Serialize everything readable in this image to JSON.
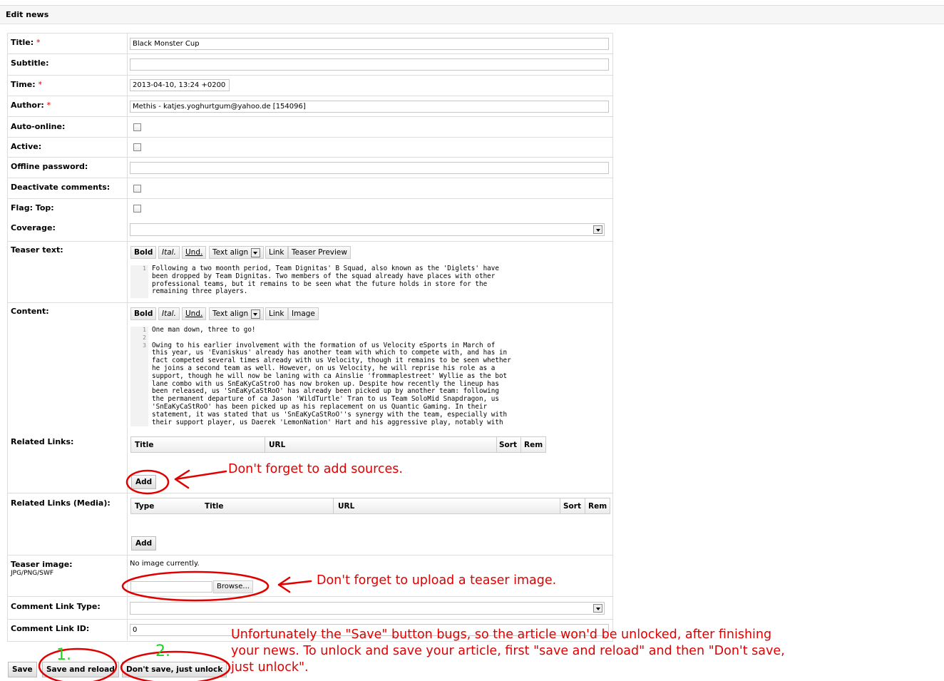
{
  "header": {
    "title": "Edit news"
  },
  "form": {
    "title_label": "Title:",
    "title_value": "Black Monster Cup",
    "subtitle_label": "Subtitle:",
    "subtitle_value": "",
    "time_label": "Time:",
    "time_value": "2013-04-10, 13:24 +0200",
    "author_label": "Author:",
    "author_value": "Methis - katjes.yoghurtgum@yahoo.de [154096]",
    "autoonline_label": "Auto-online:",
    "active_label": "Active:",
    "offline_label": "Offline password:",
    "offline_value": "",
    "deactivate_label": "Deactivate comments:",
    "flagtop_label": "Flag: Top:",
    "coverage_label": "Coverage:",
    "coverage_value": "",
    "teaser_label": "Teaser text:",
    "content_label": "Content:",
    "related_label": "Related Links:",
    "related_media_label": "Related Links (Media):",
    "teaser_image_label": "Teaser image:",
    "teaser_image_formats": "JPG/PNG/SWF",
    "no_image_text": "No image currently.",
    "browse_label": "Browse...",
    "comment_type_label": "Comment Link Type:",
    "comment_type_value": "",
    "comment_id_label": "Comment Link ID:",
    "comment_id_value": "0",
    "required_mark": "*"
  },
  "toolbar": {
    "bold": "Bold",
    "italic": "Ital.",
    "underline": "Und.",
    "text_align": "Text align",
    "link": "Link",
    "teaser_preview": "Teaser Preview",
    "image": "Image"
  },
  "teaser_editor": {
    "line_numbers": "1",
    "text": "Following a two moonth period, Team Dignitas' B Squad, also known as the 'Diglets' have\nbeen dropped by Team Dignitas. Two members of the squad already have places with other\nprofessional teams, but it remains to be seen what the future holds in store for the\nremaining three players."
  },
  "content_editor": {
    "line_numbers": "1\n2\n3",
    "text": "One man down, three to go!\n\nOwing to his earlier involvement with the formation of us Velocity eSports in March of\nthis year, us 'Evaniskus' already has another team with which to compete with, and has in\nfact competed several times already with us Velocity, though it remains to be seen whether\nhe joins a second team as well. However, on us Velocity, he will reprise his role as a\nsupport, though he will now be laning with ca Ainslie 'frommaplestreet' Wyllie as the bot\nlane combo with us SnEaKyCaStroO has now broken up. Despite how recently the lineup has\nbeen released, us 'SnEaKyCaStRoO' has already been picked up by another team: following\nthe permanent departure of ca Jason 'WildTurtle' Tran to us Team SoloMid Snapdragon, us\n'SnEaKyCaStRoO' has been picked up as his replacement on us Quantic Gaming. In their\nstatement, it was stated that us 'SnEaKyCaStRoO''s synergy with the team, especially with\ntheir support player, us Daerek 'LemonNation' Hart and his aggressive play, notably with"
  },
  "links_table": {
    "headers": [
      "Title",
      "URL",
      "Sort",
      "Rem"
    ],
    "add_label": "Add"
  },
  "media_table": {
    "headers": [
      "Type",
      "Title",
      "URL",
      "Sort",
      "Rem"
    ],
    "add_label": "Add"
  },
  "footer": {
    "save": "Save",
    "save_reload": "Save and reload",
    "dont_save": "Don't save, just unlock"
  },
  "annotations": {
    "sources_note": "Don't forget to add sources.",
    "image_note": "Don't forget to upload a teaser image.",
    "unlock_note": "Unfortunately the \"Save\" button bugs, so the article won'd be unlocked, after finishing\nyour news. To unlock and save your article, first \"save and reload\" and then \"Don't save,\njust unlock\".",
    "step1": "1.",
    "step2": "2.",
    "note_color": "#e00000",
    "step_color": "#1fd21f"
  }
}
